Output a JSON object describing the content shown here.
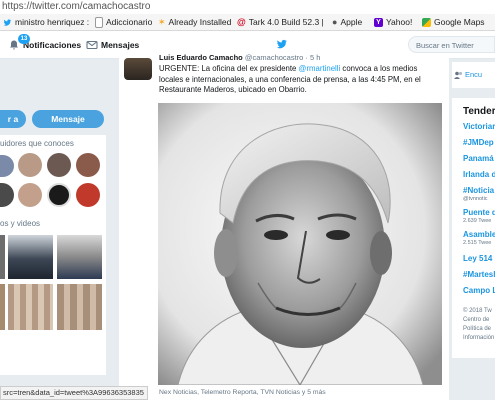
{
  "browser": {
    "url": "https://twitter.com/camachocastro",
    "bookmarks": [
      {
        "label": "ministro henriquez :",
        "icon": "twitter-icon",
        "color": "#1da1f2"
      },
      {
        "label": "Adiccionario",
        "icon": "page-icon",
        "color": "#cccccc"
      },
      {
        "label": "Already Installed",
        "icon": "star-icon",
        "color": "#f5a623"
      },
      {
        "label": "Tark 4.0 Build 52.3 |",
        "icon": "at-icon",
        "color": "#d0021b"
      },
      {
        "label": "Apple",
        "icon": "apple-icon",
        "color": "#555555"
      },
      {
        "label": "Yahoo!",
        "icon": "yahoo-icon",
        "color": "#6001d2"
      },
      {
        "label": "Google Maps",
        "icon": "maps-icon",
        "color": "#34a853"
      }
    ]
  },
  "header": {
    "notifications_label": "Notificaciones",
    "notifications_count": "13",
    "messages_label": "Mensajes",
    "search_placeholder": "Buscar en Twitter",
    "brand_color": "#1da1f2"
  },
  "left": {
    "follow_button": "r a",
    "message_button": "Mensaje",
    "followers_label": "uidores que conoces",
    "media_label": "os y videos"
  },
  "tweet": {
    "author_name": "Luis Eduardo Camacho",
    "author_handle": "@camachocastro · 5 h",
    "text_before": "URGENTE: La oficina del ex presidente ",
    "mention": "@rmartinelli",
    "text_after": " convoca a los medios locales e internacionales, a una conferencia de prensa, a las 4:45 PM, en el Restaurante Maderos, ubicado en Obarrio.",
    "caption": "Nex Noticias, Telemetro Reporta, TVN Noticias y 5 más"
  },
  "right": {
    "search_link": "Encu",
    "trends_title": "Tender",
    "trends": [
      {
        "label": "Victoriar",
        "sub": ""
      },
      {
        "label": "#JMDep",
        "sub": ""
      },
      {
        "label": "Panamá",
        "sub": ""
      },
      {
        "label": "Irlanda d",
        "sub": ""
      },
      {
        "label": "#Noticia",
        "sub": "@tvnnotic"
      },
      {
        "label": "Puente d",
        "sub": "2.639 Twee"
      },
      {
        "label": "Asamble",
        "sub": "2.515 Twee"
      },
      {
        "label": "Ley 514",
        "sub": ""
      },
      {
        "label": "#Martesl",
        "sub": ""
      },
      {
        "label": "Campo L",
        "sub": ""
      }
    ],
    "footer_lines": [
      "© 2018 Tw",
      "Centro de",
      "Política de",
      "Información"
    ]
  },
  "statusbar": {
    "text": "src=tren&data_id=tweet%3A99636353835"
  }
}
